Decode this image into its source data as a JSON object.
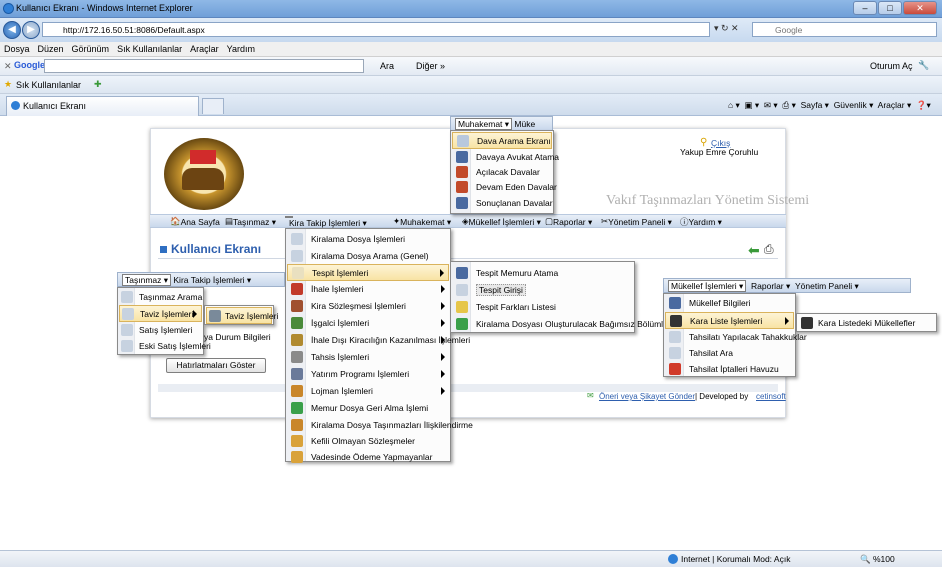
{
  "window": {
    "title": "Kullanıcı Ekranı - Windows Internet Explorer",
    "min": "–",
    "max": "□",
    "close": "✕"
  },
  "address": {
    "url": "http://172.16.50.51:8086/Default.aspx",
    "search_placeholder": "Google"
  },
  "menubar": [
    "Dosya",
    "Düzen",
    "Görünüm",
    "Sık Kullanılanlar",
    "Araçlar",
    "Yardım"
  ],
  "google_bar": {
    "brand": "Google",
    "search": "Ara",
    "more": "Diğer »",
    "signin": "Oturum Aç"
  },
  "favorites": {
    "label": "Sık Kullanılanlar"
  },
  "tab": {
    "title": "Kullanıcı Ekranı"
  },
  "ie_cmd": [
    "Sayfa ▾",
    "Güvenlik ▾",
    "Araçlar ▾"
  ],
  "header": {
    "logout": "Çıkış",
    "user": "Yakup Emre Çoruhlu",
    "system": "Vakıf Taşınmazları Yönetim Sistemi"
  },
  "nav": [
    "Ana Sayfa",
    "Taşınmaz ▾",
    "Kira Takip İşlemleri ▾",
    "Muhakemat ▾",
    "Mükellef İşlemleri ▾",
    "Raporlar ▾",
    "Yönetim Paneli ▾",
    "Yardım ▾"
  ],
  "page_title": "Kullanıcı Ekranı",
  "muhakemat_bar": {
    "label": "Muhakemat ▾",
    "next": "Müke"
  },
  "muhakemat_items": [
    "Dava Arama Ekranı",
    "Davaya Avukat Atama",
    "Açılacak Davalar",
    "Devam Eden Davalar",
    "Sonuçlanan Davalar"
  ],
  "kira_items": [
    "Kiralama Dosya İşlemleri",
    "Kiralama Dosya Arama (Genel)",
    "Tespit İşlemleri",
    "İhale İşlemleri",
    "Kira Sözleşmesi İşlemleri",
    "İşgalci İşlemleri",
    "İhale Dışı Kiracılığın Kazanılması İşlemleri",
    "Tahsis İşlemleri",
    "Yatırım Programı İşlemleri",
    "Lojman İşlemleri",
    "Memur Dosya Geri Alma İşlemi",
    "Kiralama Dosya Taşınmazları İlişkilendirme",
    "Kefili Olmayan Sözleşmeler",
    "Vadesinde Ödeme Yapmayanlar"
  ],
  "tespit_items": [
    "Tespit Memuru Atama",
    "Tespit Girişi",
    "Tespit Farkları Listesi",
    "Kiralama Dosyası Oluşturulacak Bağımsız Bölümler"
  ],
  "tasinmaz_bar": {
    "label": "Taşınmaz ▾",
    "next": "Kira Takip İşlemleri ▾"
  },
  "tasinmaz_items": [
    "Taşınmaz Arama",
    "Taviz İşlemleri",
    "Satış İşlemleri",
    "Eski Satış İşlemleri"
  ],
  "taviz_sub": "Taviz İşlemleri",
  "dosya_durum": "ya Durum Bilgileri",
  "hatirlatma_btn": "Hatırlatmaları Göster",
  "mukellef_bar": {
    "label": "Mükellef İşlemleri ▾",
    "reports": "Raporlar ▾",
    "panel": "Yönetim Paneli ▾"
  },
  "mukellef_items": [
    "Mükellef Bilgileri",
    "Kara Liste İşlemleri",
    "Tahsilatı Yapılacak Tahakkuklar",
    "Tahsilat Ara",
    "Tahsilat İptalleri Havuzu"
  ],
  "kara_sub": "Kara Listedeki Mükellefler",
  "footer": {
    "link": "Öneri veya Şikayet Gönder",
    "dev": "| Developed by",
    "company": "cetinsoft"
  },
  "status": {
    "zone": "Internet | Korumalı Mod: Açık",
    "zoom": "%100"
  }
}
